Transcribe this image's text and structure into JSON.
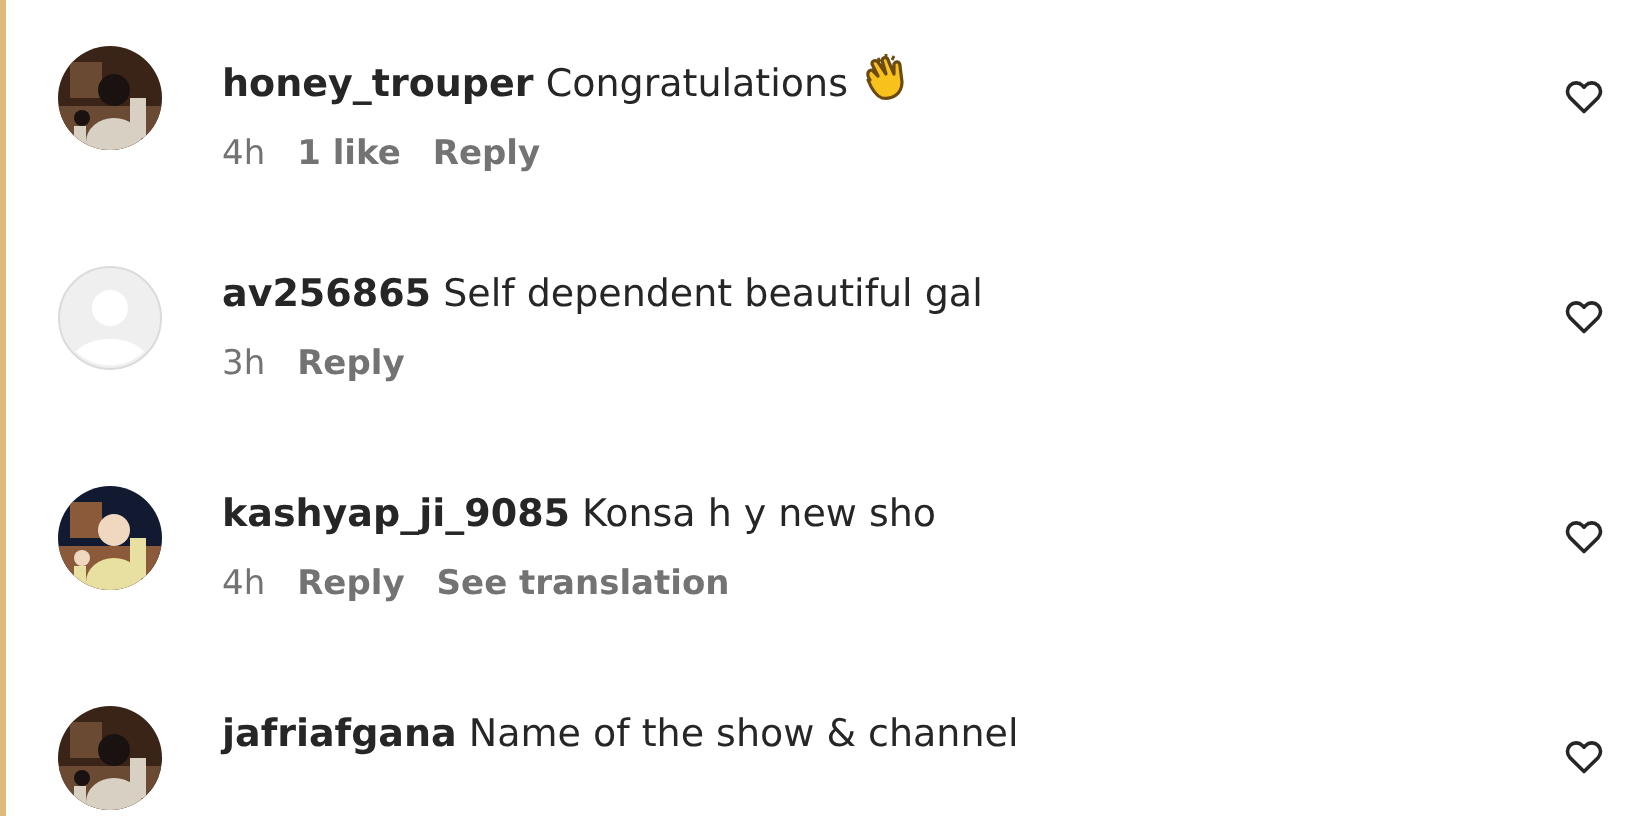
{
  "comments": [
    {
      "avatar": {
        "kind": "picture"
      },
      "username": "honey_trouper",
      "text": "Congratulations",
      "clap_emoji": true,
      "meta": [
        {
          "kind": "time",
          "label": "4h"
        },
        {
          "kind": "action",
          "label": "1 like"
        },
        {
          "kind": "action",
          "label": "Reply"
        }
      ],
      "liked": false
    },
    {
      "avatar": {
        "kind": "default"
      },
      "username": "av256865",
      "text": "Self dependent beautiful gal",
      "meta": [
        {
          "kind": "time",
          "label": "3h"
        },
        {
          "kind": "action",
          "label": "Reply"
        }
      ],
      "liked": false
    },
    {
      "avatar": {
        "kind": "picture"
      },
      "username": "kashyap_ji_9085",
      "text": "Konsa h y new sho",
      "meta": [
        {
          "kind": "time",
          "label": "4h"
        },
        {
          "kind": "action",
          "label": "Reply"
        },
        {
          "kind": "action",
          "label": "See translation"
        }
      ],
      "liked": false
    },
    {
      "avatar": {
        "kind": "picture"
      },
      "username": "jafriafgana",
      "text": "Name of the show & channel",
      "liked": false
    }
  ]
}
